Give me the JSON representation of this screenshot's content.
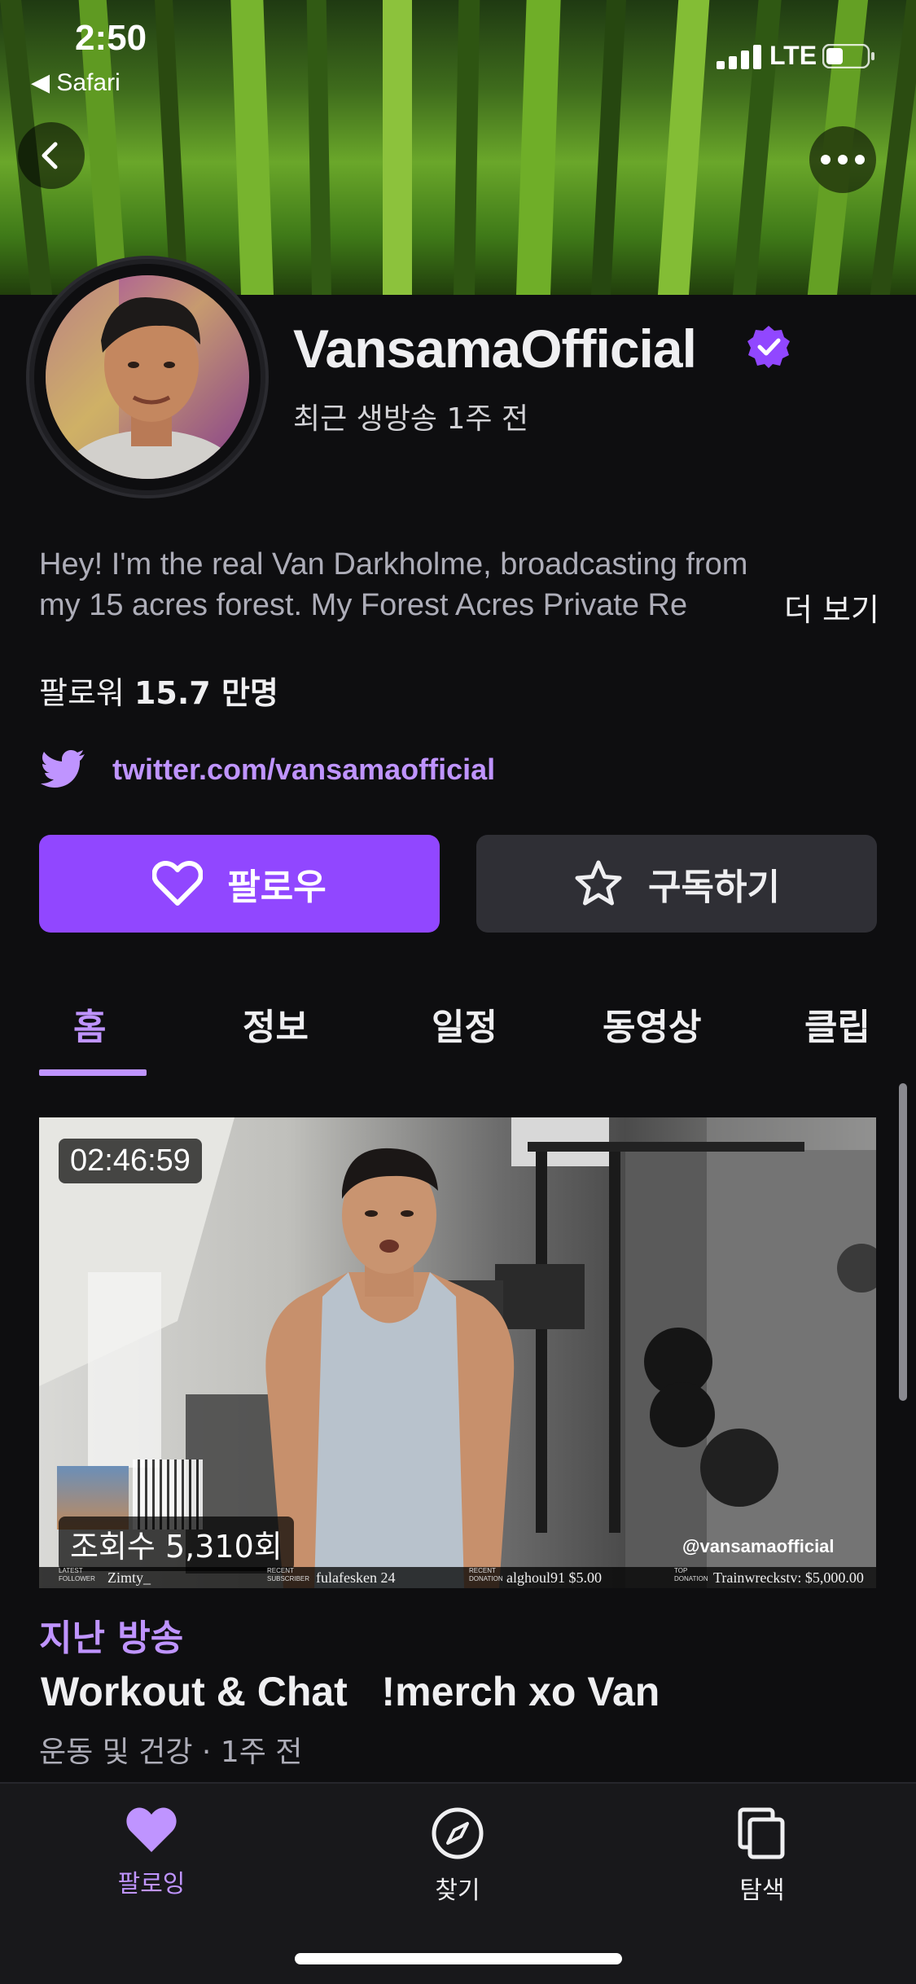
{
  "status_bar": {
    "time": "2:50",
    "back_app": "◀ Safari",
    "carrier": "LTE"
  },
  "channel": {
    "name": "VansamaOfficial",
    "verified": true,
    "last_live": "최근 생방송 1주 전",
    "bio_line1": "Hey! I'm the real Van Darkholme, broadcasting from",
    "bio_line2": "my 15 acres forest. My Forest Acres Private Re",
    "more": "더 보기",
    "followers_label": "팔로워",
    "followers_count": "15.7 만명",
    "twitter": "twitter.com/vansamaofficial"
  },
  "actions": {
    "follow": "팔로우",
    "subscribe": "구독하기"
  },
  "tabs": [
    "홈",
    "정보",
    "일정",
    "동영상",
    "클립"
  ],
  "active_tab": "홈",
  "video": {
    "duration": "02:46:59",
    "views": "조회수 5,310회",
    "watermark": "@vansamaofficial",
    "ticker": {
      "latest_follower_label": "LATEST FOLLOWER",
      "latest_follower": "Zimty_",
      "recent_sub_label": "RECENT SUBSCRIBER",
      "recent_sub": "fulafesken 24",
      "recent_donation_label": "RECENT DONATION",
      "recent_donation": "alghoul91 $5.00",
      "top_donation_label": "TOP DONATION",
      "top_donation": "Trainwreckstv: $5,000.00"
    },
    "label": "지난 방송",
    "title": "Workout & Chat   !merch xo Van",
    "meta": "운동 및 건강 · 1주 전"
  },
  "bottom_nav": [
    {
      "label": "팔로잉",
      "icon": "heart-icon",
      "active": true
    },
    {
      "label": "찾기",
      "icon": "compass-icon",
      "active": false
    },
    {
      "label": "탐색",
      "icon": "browse-icon",
      "active": false
    }
  ],
  "colors": {
    "accent": "#9147ff",
    "accent_text": "#bf94ff",
    "background": "#0e0e10"
  }
}
